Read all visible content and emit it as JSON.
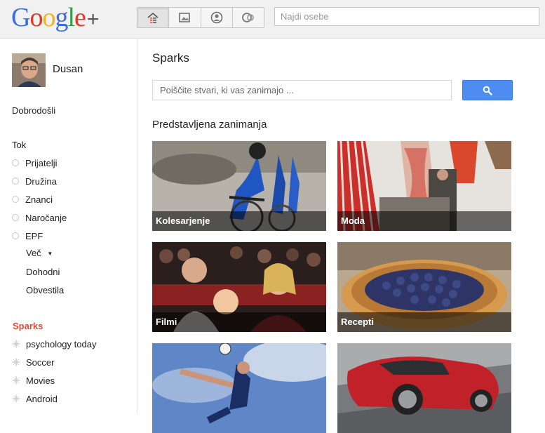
{
  "app": {
    "logo": "Google+"
  },
  "header": {
    "nav": [
      {
        "icon": "home-icon"
      },
      {
        "icon": "photos-icon"
      },
      {
        "icon": "profile-icon"
      },
      {
        "icon": "circles-icon"
      }
    ],
    "search_placeholder": "Najdi osebe"
  },
  "sidebar": {
    "user_name": "Dusan",
    "welcome": "Dobrodošli",
    "stream_label": "Tok",
    "circles": [
      "Prijatelji",
      "Družina",
      "Znanci",
      "Naročanje",
      "EPF"
    ],
    "more_label": "Več",
    "incoming": "Dohodni",
    "notifications": "Obvestila",
    "sparks_label": "Sparks",
    "sparks": [
      "psychology today",
      "Soccer",
      "Movies",
      "Android"
    ]
  },
  "main": {
    "title": "Sparks",
    "search_placeholder": "Poiščite stvari, ki vas zanimajo ...",
    "featured_title": "Predstavljena zanimanja",
    "tiles": [
      "Kolesarjenje",
      "Moda",
      "Filmi",
      "Recepti",
      "",
      ""
    ]
  },
  "colors": {
    "accent_red": "#dd4b39",
    "search_blue": "#4d8cf0"
  }
}
